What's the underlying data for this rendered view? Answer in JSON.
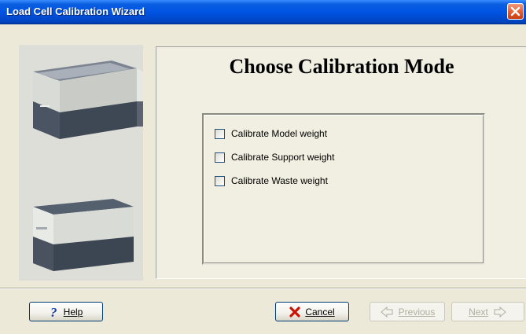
{
  "window": {
    "title": "Load Cell Calibration Wizard"
  },
  "main": {
    "heading": "Choose Calibration Mode",
    "options": [
      {
        "label": "Calibrate Model weight",
        "checked": false
      },
      {
        "label": "Calibrate Support weight",
        "checked": false
      },
      {
        "label": "Calibrate Waste weight",
        "checked": false
      }
    ]
  },
  "footer": {
    "help_label": "Help",
    "cancel_label": "Cancel",
    "previous_label": "Previous",
    "next_label": "Next"
  },
  "icons": {
    "close": "close-icon",
    "help": "question-mark-icon",
    "cancel": "red-x-icon",
    "previous": "arrow-left-icon",
    "next": "arrow-right-icon",
    "printer": "printer-image"
  },
  "colors": {
    "titlebar": "#0054e3",
    "close": "#e35b2e",
    "cancel_x": "#cc1100"
  }
}
